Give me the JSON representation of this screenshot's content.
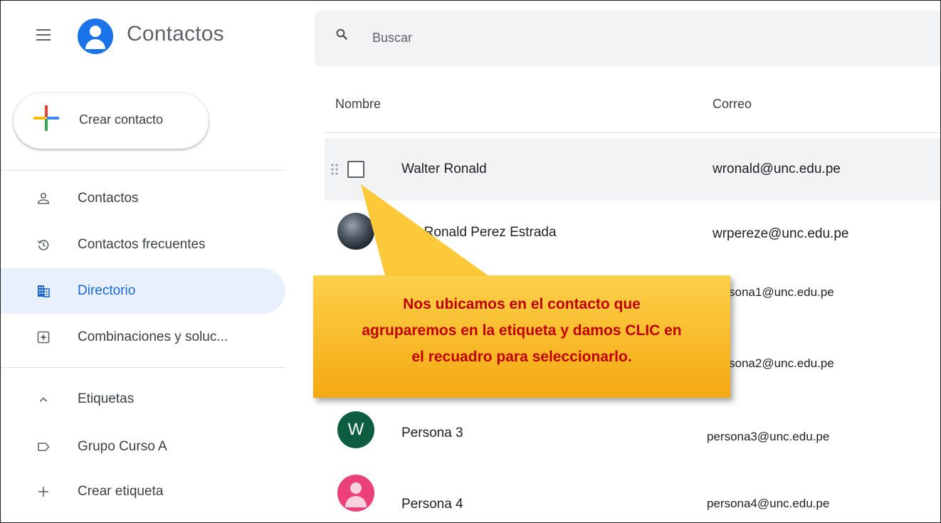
{
  "header": {
    "app_title": "Contactos",
    "search_placeholder": "Buscar",
    "brand_color": "#1a73e8"
  },
  "sidebar": {
    "create_button_label": "Crear contacto",
    "items": [
      {
        "label": "Contactos",
        "icon": "person-outline-icon",
        "active": false
      },
      {
        "label": "Contactos frecuentes",
        "icon": "history-icon",
        "active": false
      },
      {
        "label": "Directorio",
        "icon": "building-icon",
        "active": true
      },
      {
        "label": "Combinaciones y soluc...",
        "icon": "merge-fix-icon",
        "active": false
      }
    ],
    "labels_section": {
      "header": "Etiquetas",
      "toggle_icon": "chevron-up-icon",
      "items": [
        {
          "label": "Grupo Curso A",
          "icon": "label-icon"
        }
      ],
      "create_label": "Crear etiqueta"
    }
  },
  "table": {
    "columns": [
      "Nombre",
      "Correo"
    ],
    "rows": [
      {
        "name": "Walter Ronald",
        "email": "wronald@unc.edu.pe",
        "avatar": "checkbox"
      },
      {
        "name": "lter Ronald Perez Estrada",
        "email": "wrpereze@unc.edu.pe",
        "avatar": "photo"
      },
      {
        "name": "",
        "email": "sona1@unc.edu.pe",
        "avatar": "hidden"
      },
      {
        "name": "",
        "email": "sona2@unc.edu.pe",
        "avatar": "hidden"
      },
      {
        "name": "Persona 3",
        "email": "persona3@unc.edu.pe",
        "avatar": "W"
      },
      {
        "name": "Persona 4",
        "email": "persona4@unc.edu.pe",
        "avatar": "person-icon"
      }
    ]
  },
  "callout": {
    "line1": "Nos ubicamos en el contacto que",
    "line2": "agruparemos en la etiqueta y damos CLIC en",
    "line3": "el recuadro para seleccionarlo.",
    "text_color": "#c00000",
    "background": "#fbbf24"
  }
}
